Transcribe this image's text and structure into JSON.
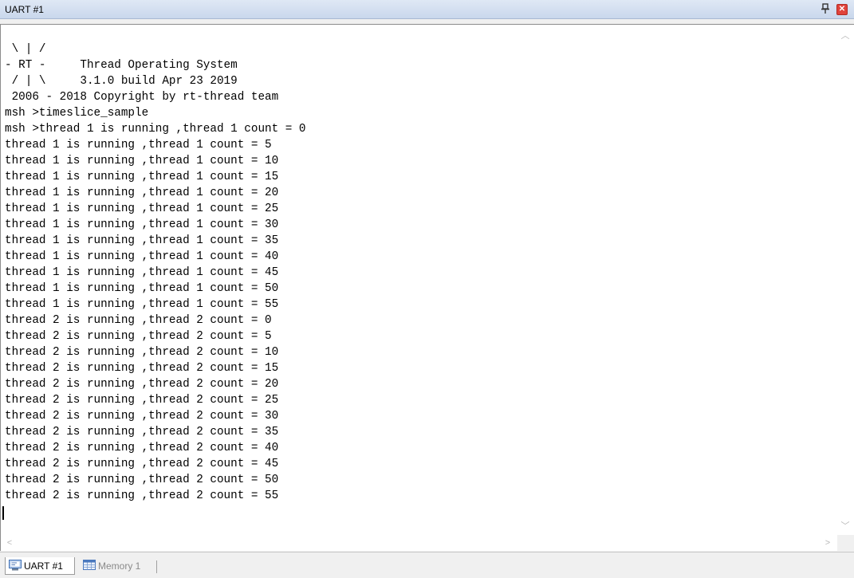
{
  "window": {
    "title": "UART #1",
    "pin_glyph": "ᵖ",
    "close_glyph": "✕"
  },
  "terminal": {
    "lines": [
      " \\ | /",
      "- RT -     Thread Operating System",
      " / | \\     3.1.0 build Apr 23 2019",
      " 2006 - 2018 Copyright by rt-thread team",
      "msh >timeslice_sample",
      "msh >thread 1 is running ,thread 1 count = 0",
      "thread 1 is running ,thread 1 count = 5",
      "thread 1 is running ,thread 1 count = 10",
      "thread 1 is running ,thread 1 count = 15",
      "thread 1 is running ,thread 1 count = 20",
      "thread 1 is running ,thread 1 count = 25",
      "thread 1 is running ,thread 1 count = 30",
      "thread 1 is running ,thread 1 count = 35",
      "thread 1 is running ,thread 1 count = 40",
      "thread 1 is running ,thread 1 count = 45",
      "thread 1 is running ,thread 1 count = 50",
      "thread 1 is running ,thread 1 count = 55",
      "thread 2 is running ,thread 2 count = 0",
      "thread 2 is running ,thread 2 count = 5",
      "thread 2 is running ,thread 2 count = 10",
      "thread 2 is running ,thread 2 count = 15",
      "thread 2 is running ,thread 2 count = 20",
      "thread 2 is running ,thread 2 count = 25",
      "thread 2 is running ,thread 2 count = 30",
      "thread 2 is running ,thread 2 count = 35",
      "thread 2 is running ,thread 2 count = 40",
      "thread 2 is running ,thread 2 count = 45",
      "thread 2 is running ,thread 2 count = 50",
      "thread 2 is running ,thread 2 count = 55"
    ]
  },
  "scrollbars": {
    "up": "︿",
    "down": "﹀",
    "left": "<",
    "right": ">"
  },
  "tabs": [
    {
      "label": "UART #1",
      "active": true
    },
    {
      "label": "Memory 1",
      "active": false
    }
  ]
}
